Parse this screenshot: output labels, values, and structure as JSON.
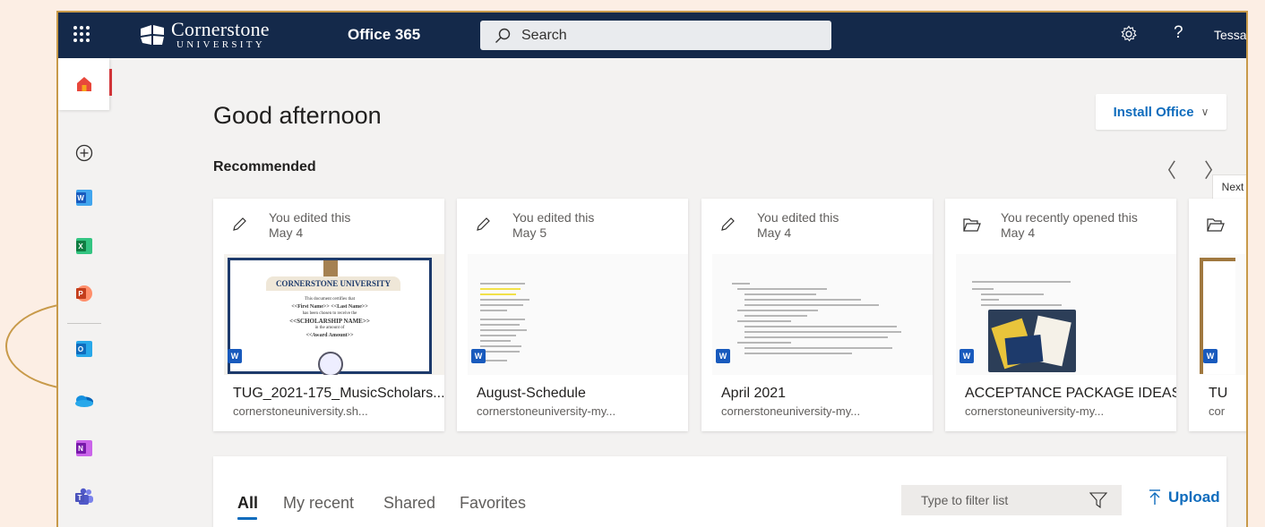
{
  "topbar": {
    "org_name": "Cornerstone",
    "org_sub": "UNIVERSITY",
    "app_title": "Office 365",
    "search_placeholder": "Search",
    "user_name": "Tessa Co"
  },
  "rail": {
    "items": [
      {
        "name": "home",
        "icon": "home-icon",
        "color": "#d83b01"
      },
      {
        "name": "create",
        "icon": "plus-circle-icon"
      },
      {
        "name": "word",
        "icon": "word-icon",
        "letter": "W",
        "color": "#185abd"
      },
      {
        "name": "excel",
        "icon": "excel-icon",
        "letter": "X",
        "color": "#107c41"
      },
      {
        "name": "powerpoint",
        "icon": "powerpoint-icon",
        "letter": "P",
        "color": "#c43e1c"
      },
      {
        "name": "outlook",
        "icon": "outlook-icon",
        "letter": "O",
        "color": "#0f6cbd"
      },
      {
        "name": "onedrive",
        "icon": "onedrive-icon",
        "color": "#0364b8"
      },
      {
        "name": "onenote",
        "icon": "onenote-icon",
        "letter": "N",
        "color": "#7719aa"
      },
      {
        "name": "teams",
        "icon": "teams-icon",
        "color": "#5059c9"
      }
    ]
  },
  "main": {
    "greeting": "Good afternoon",
    "install_label": "Install Office",
    "recommended_label": "Recommended",
    "next_tooltip": "Next",
    "cards": [
      {
        "activity": "You edited this",
        "date": "May 4",
        "name": "TUG_2021-175_MusicScholars...",
        "location": "cornerstoneuniversity.sh...",
        "icon": "pencil-icon"
      },
      {
        "activity": "You edited this",
        "date": "May 5",
        "name": "August-Schedule",
        "location": "cornerstoneuniversity-my...",
        "icon": "pencil-icon"
      },
      {
        "activity": "You edited this",
        "date": "May 4",
        "name": "April 2021",
        "location": "cornerstoneuniversity-my...",
        "icon": "pencil-icon"
      },
      {
        "activity": "You recently opened this",
        "date": "May 4",
        "name": "ACCEPTANCE PACKAGE IDEAS",
        "location": "cornerstoneuniversity-my...",
        "icon": "folder-open-icon"
      },
      {
        "activity": "",
        "date": "",
        "name": "TU",
        "location": "cor",
        "icon": "folder-open-icon"
      }
    ],
    "cert": {
      "heading": "CORNERSTONE UNIVERSITY",
      "line1": "This document certifies that",
      "line2": "<<First Name>> <<Last Name>>",
      "line3": "has been chosen to receive the",
      "line4": "<<SCHOLARSHIP NAME>>",
      "line5": "in the amount of",
      "line6": "<<Award Amount>>"
    },
    "file_tabs": [
      "All",
      "My recent",
      "Shared",
      "Favorites"
    ],
    "filter_placeholder": "Type to filter list",
    "upload_label": "Upload"
  }
}
